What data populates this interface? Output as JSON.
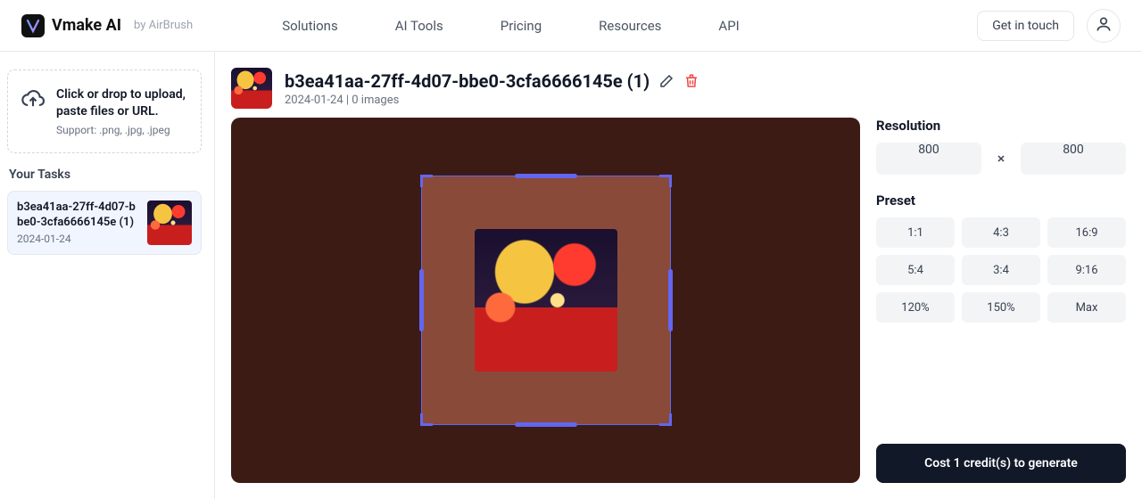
{
  "header": {
    "brand_name": "Vmake AI",
    "brand_byline": "by AirBrush",
    "nav": {
      "solutions": "Solutions",
      "ai_tools": "AI Tools",
      "pricing": "Pricing",
      "resources": "Resources",
      "api": "API"
    },
    "get_in_touch": "Get in touch"
  },
  "sidebar": {
    "upload_line1": "Click or drop to upload, paste files or URL.",
    "upload_support": "Support: .png, .jpg, .jpeg",
    "tasks_title": "Your Tasks",
    "tasks": [
      {
        "title": "b3ea41aa-27ff-4d07-bbe0-3cfa6666145e (1)",
        "date": "2024-01-24"
      }
    ]
  },
  "document": {
    "title": "b3ea41aa-27ff-4d07-bbe0-3cfa6666145e (1)",
    "meta": "2024-01-24 | 0 images"
  },
  "resolution": {
    "label": "Resolution",
    "width": "800",
    "height": "800"
  },
  "preset": {
    "label": "Preset",
    "items": [
      "1:1",
      "4:3",
      "16:9",
      "5:4",
      "3:4",
      "9:16",
      "120%",
      "150%",
      "Max"
    ]
  },
  "generate_label": "Cost 1 credit(s) to generate"
}
